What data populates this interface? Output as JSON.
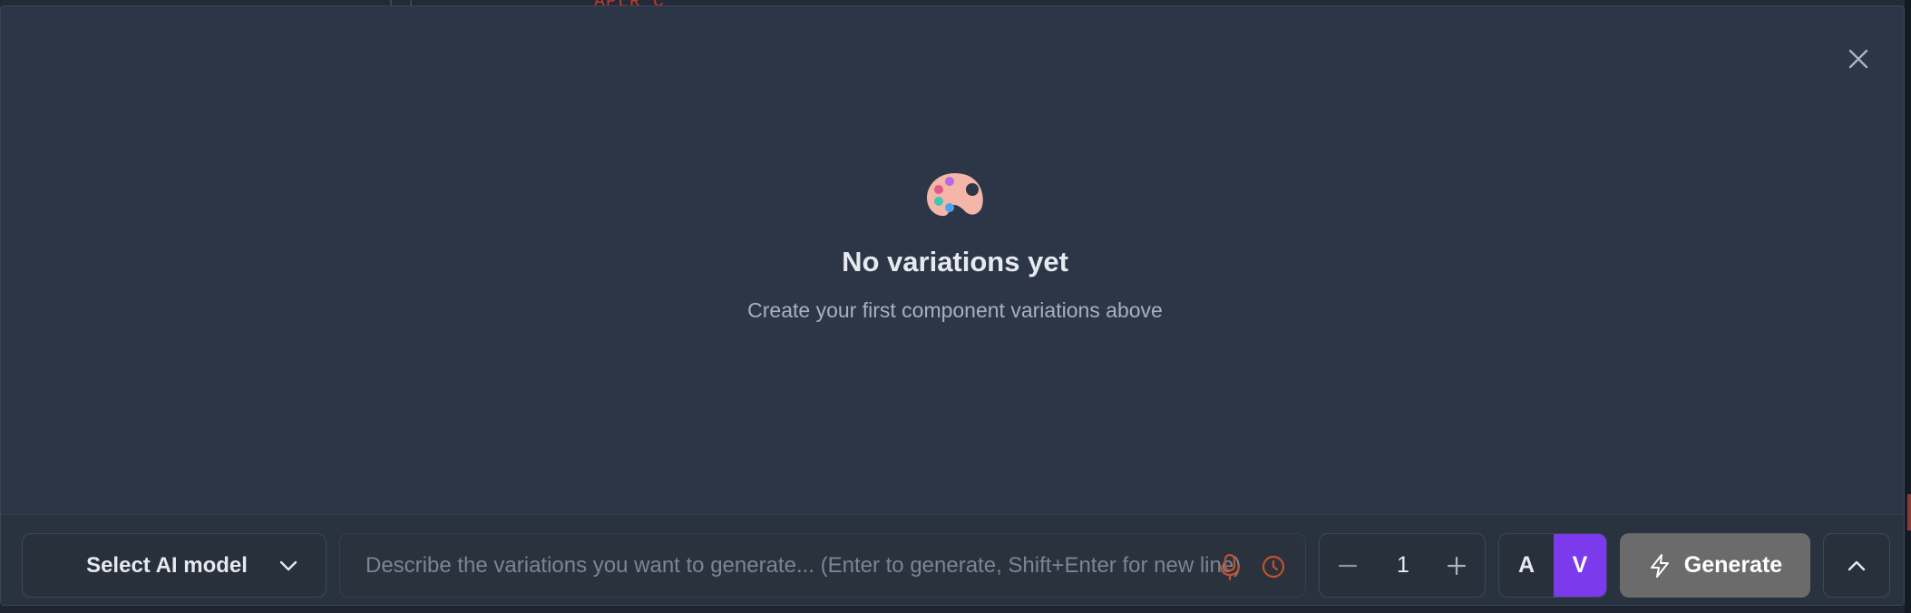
{
  "background": {
    "code_fragment": "APLR_C"
  },
  "panel": {
    "close_icon": "close-icon"
  },
  "empty_state": {
    "icon": "palette-icon",
    "title": "No variations yet",
    "subtitle": "Create your first component variations above"
  },
  "toolbar": {
    "model_select_label": "Select AI model",
    "prompt_placeholder": "Describe the variations you want to generate... (Enter to generate, Shift+Enter for new line)",
    "prompt_value": "",
    "variation_count": "1",
    "mode_a_label": "A",
    "mode_v_label": "V",
    "generate_label": "Generate"
  },
  "colors": {
    "panel_bg": "#2c3647",
    "accent_purple": "#7c3aed",
    "mic_history_orange": "#c2512f",
    "generate_disabled": "#6b6b6b"
  }
}
